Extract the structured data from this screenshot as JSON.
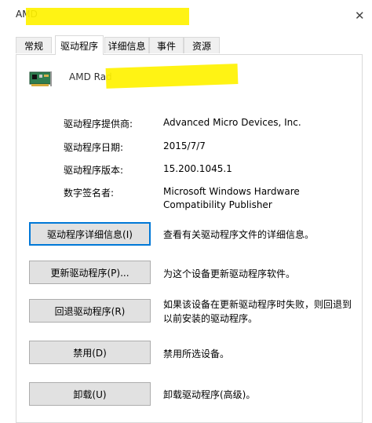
{
  "window": {
    "title": "AMD",
    "close_glyph": "✕"
  },
  "tabs": [
    {
      "label": "常规"
    },
    {
      "label": "驱动程序",
      "active": true
    },
    {
      "label": "详细信息"
    },
    {
      "label": "事件"
    },
    {
      "label": "资源"
    }
  ],
  "device": {
    "icon": "network-card-icon",
    "name": "AMD Rad"
  },
  "properties": {
    "provider_label": "驱动程序提供商:",
    "provider_value": "Advanced Micro Devices, Inc.",
    "date_label": "驱动程序日期:",
    "date_value": "2015/7/7",
    "version_label": "驱动程序版本:",
    "version_value": "15.200.1045.1",
    "signer_label": "数字签名者:",
    "signer_value_line1": "Microsoft Windows Hardware",
    "signer_value_line2": "Compatibility Publisher"
  },
  "actions": {
    "details_button": "驱动程序详细信息(I)",
    "details_desc": "查看有关驱动程序文件的详细信息。",
    "update_button": "更新驱动程序(P)...",
    "update_desc": "为这个设备更新驱动程序软件。",
    "rollback_button": "回退驱动程序(R)",
    "rollback_desc_line1": "如果该设备在更新驱动程序时失败，则回退到",
    "rollback_desc_line2": "以前安装的驱动程序。",
    "disable_button": "禁用(D)",
    "disable_desc": "禁用所选设备。",
    "uninstall_button": "卸载(U)",
    "uninstall_desc": "卸载驱动程序(高级)。"
  },
  "colors": {
    "highlight": "#fff200",
    "focus_border": "#0078d7"
  }
}
